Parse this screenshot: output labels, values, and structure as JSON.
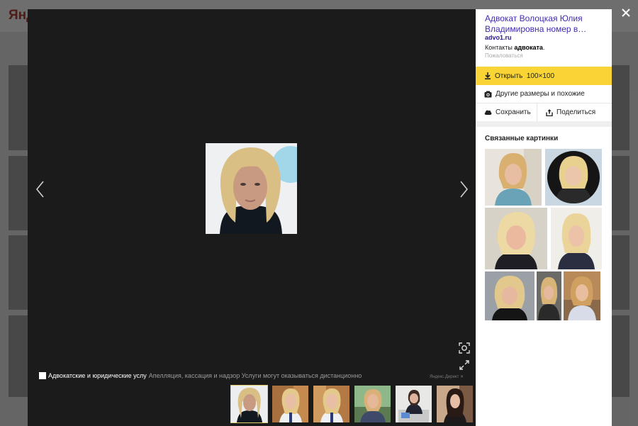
{
  "background_page": {
    "logo_text": "Янд"
  },
  "viewer": {
    "caption": {
      "title": "Адвокатские и юридические услу",
      "text": "Апелляция, кассация и надзор Услуги могут оказываться дистанционно",
      "ad_mark": "Яндекс.Директ ✕"
    },
    "icons": {
      "prev": "chevron-left-icon",
      "next": "chevron-right-icon",
      "search_image": "image-search-icon",
      "fullscreen": "fullscreen-icon",
      "close": "close-icon"
    },
    "thumbnails": [
      {
        "palette": "blonde-portrait",
        "active": true
      },
      {
        "palette": "office-blonde",
        "active": false
      },
      {
        "palette": "office-blonde",
        "active": false
      },
      {
        "palette": "outdoor-woman",
        "active": false
      },
      {
        "palette": "office-desk",
        "active": false
      },
      {
        "palette": "dark-hair",
        "active": false
      }
    ]
  },
  "panel": {
    "title": "Адвокат Волоцкая Юлия Владимировна номер в…",
    "domain": "advo1.ru",
    "desc_prefix": "Контакты ",
    "desc_bold": "адвоката",
    "desc_suffix": ".",
    "complain": "Пожаловаться",
    "open_label": "Открыть",
    "open_size": "100×100",
    "similar_label": "Другие размеры и похожие",
    "save_label": "Сохранить",
    "share_label": "Поделиться",
    "related_title": "Связанные картинки"
  },
  "colors": {
    "accent_yellow": "#f8d434",
    "link_purple": "#3f2bb5",
    "viewer_bg": "#1b1b1b"
  }
}
